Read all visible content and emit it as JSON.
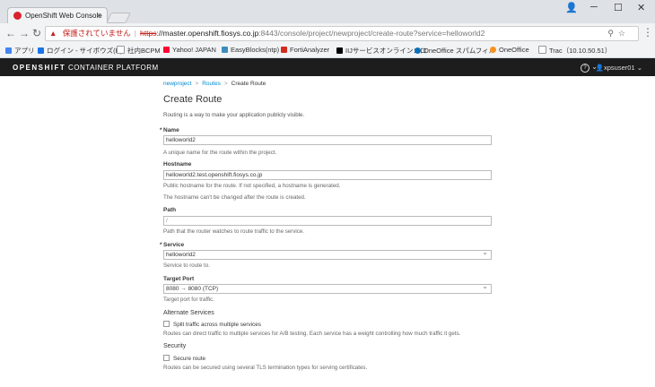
{
  "browser": {
    "tab_title": "OpenShift Web Console",
    "security_warning": "保護されていません",
    "url_scheme": "https",
    "url_host": "://master.openshift.fiosys.co.jp",
    "url_path": ":8443/console/project/newproject/create-route?service=helloworld2",
    "bookmarks": [
      "アプリ",
      "ログイン - サイボウズ(R)",
      "社内BCPM",
      "Yahoo! JAPAN",
      "EasyBlocks(ntp)",
      "FortiAnalyzer",
      "IIJサービスオンライン：ロ",
      "OneOffice スパムフィル",
      "OneOffice",
      "Trac（10.10.50.51）"
    ]
  },
  "header": {
    "brand_bold": "OPENSHIFT",
    "brand_rest": " CONTAINER PLATFORM",
    "help": "?",
    "user": "xpsuser01"
  },
  "breadcrumb": {
    "project": "newproject",
    "section": "Routes",
    "current": "Create Route"
  },
  "page": {
    "title": "Create Route",
    "intro": "Routing is a way to make your application publicly visible."
  },
  "form": {
    "name": {
      "label": "Name",
      "value": "helloworld2",
      "help": "A unique name for the route within the project."
    },
    "hostname": {
      "label": "Hostname",
      "value": "helloworld2.test.openshift.fiosys.co.jp",
      "help1": "Public hostname for the route. If not specified, a hostname is generated.",
      "help2": "The hostname can't be changed after the route is created."
    },
    "path": {
      "label": "Path",
      "value": "/",
      "help": "Path that the router watches to route traffic to the service."
    },
    "service": {
      "label": "Service",
      "value": "helloworld2",
      "help": "Service to route to."
    },
    "target_port": {
      "label": "Target Port",
      "value": "8080 → 8080 (TCP)",
      "help": "Target port for traffic."
    },
    "alternate": {
      "heading": "Alternate Services",
      "checkbox": "Split traffic across multiple services",
      "help": "Routes can direct traffic to multiple services for A/B testing. Each service has a weight controlling how much traffic it gets."
    },
    "security": {
      "heading": "Security",
      "checkbox": "Secure route",
      "help": "Routes can be secured using several TLS termination types for serving certificates."
    }
  }
}
